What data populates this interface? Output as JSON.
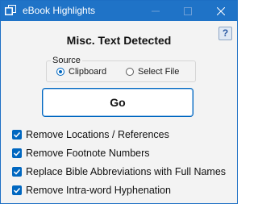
{
  "window": {
    "title": "eBook Highlights",
    "app_icon": "windows-app-icon",
    "controls": [
      "minimize-icon",
      "maximize-icon",
      "close-icon"
    ]
  },
  "help": {
    "label": "?",
    "icon": "help-icon"
  },
  "heading": "Misc. Text Detected",
  "source": {
    "legend": "Source",
    "options": [
      {
        "label": "Clipboard",
        "selected": true
      },
      {
        "label": "Select File",
        "selected": false
      }
    ]
  },
  "go_button": {
    "label": "Go"
  },
  "options": [
    {
      "label": "Remove Locations / References",
      "checked": true
    },
    {
      "label": "Remove Footnote Numbers",
      "checked": true
    },
    {
      "label": "Replace Bible Abbreviations with Full Names",
      "checked": true
    },
    {
      "label": "Remove Intra-word Hyphenation",
      "checked": true
    }
  ],
  "colors": {
    "titlebar": "#1f73c7",
    "accent": "#0067c0",
    "background": "#f3f3f3"
  }
}
